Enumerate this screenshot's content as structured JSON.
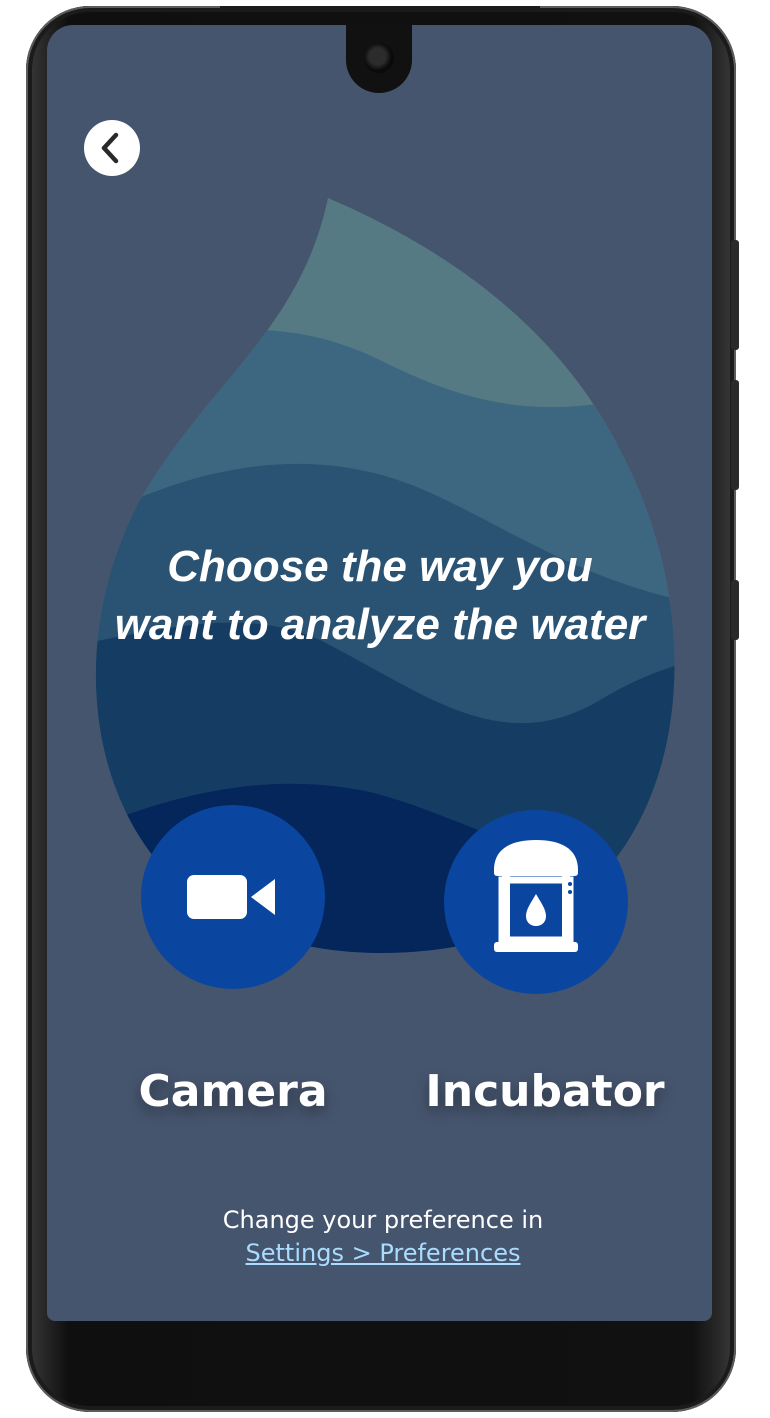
{
  "screen": {
    "headline_line1": "Choose the way you",
    "headline_line2": "want to analyze the water",
    "background_color": "#46556e",
    "accent_color": "#0a46a0"
  },
  "back_button": {
    "icon": "chevron-left-icon"
  },
  "options": [
    {
      "label": "Camera",
      "icon": "video-camera-icon"
    },
    {
      "label": "Incubator",
      "icon": "incubator-icon"
    }
  ],
  "footer": {
    "text": "Change your preference in",
    "link": "Settings > Preferences",
    "link_color": "#a9dcff"
  }
}
